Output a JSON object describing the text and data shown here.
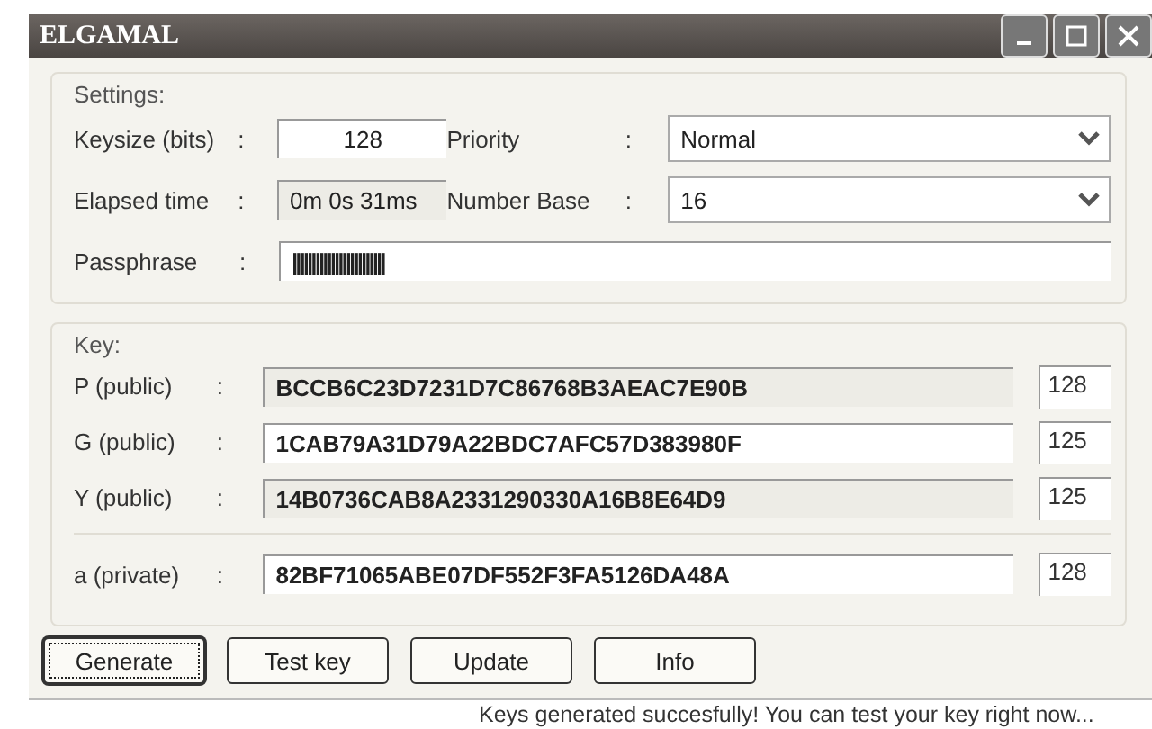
{
  "window": {
    "title": "ELGAMAL"
  },
  "settings": {
    "title": "Settings:",
    "keysize": {
      "label": "Keysize (bits)",
      "colon": ":",
      "value": "128"
    },
    "elapsed": {
      "label": "Elapsed time",
      "colon": ":",
      "value": "0m 0s 31ms"
    },
    "passphrase": {
      "label": "Passphrase",
      "colon": ":",
      "value": "||||||||||||||||||||||||"
    },
    "priority": {
      "label": "Priority",
      "colon": ":",
      "value": "Normal"
    },
    "number_base": {
      "label": "Number Base",
      "colon": ":",
      "value": "16"
    }
  },
  "key": {
    "title": "Key:",
    "rows": [
      {
        "label": "P (public)",
        "colon": ":",
        "value": "BCCB6C23D7231D7C86768B3AEAC7E90B",
        "readonly": true,
        "bits": "128"
      },
      {
        "label": "G (public)",
        "colon": ":",
        "value": "1CAB79A31D79A22BDC7AFC57D383980F",
        "readonly": false,
        "bits": "125"
      },
      {
        "label": "Y (public)",
        "colon": ":",
        "value": "14B0736CAB8A2331290330A16B8E64D9",
        "readonly": true,
        "bits": "125"
      },
      {
        "label": "a (private)",
        "colon": ":",
        "value": "82BF71065ABE07DF552F3FA5126DA48A",
        "readonly": false,
        "bits": "128"
      }
    ]
  },
  "buttons": [
    {
      "label": "Generate",
      "selected": true
    },
    {
      "label": "Test key",
      "selected": false
    },
    {
      "label": "Update",
      "selected": false
    },
    {
      "label": "Info",
      "selected": false
    }
  ],
  "status_bar": "Keys generated succesfully! You can test your key right now..."
}
